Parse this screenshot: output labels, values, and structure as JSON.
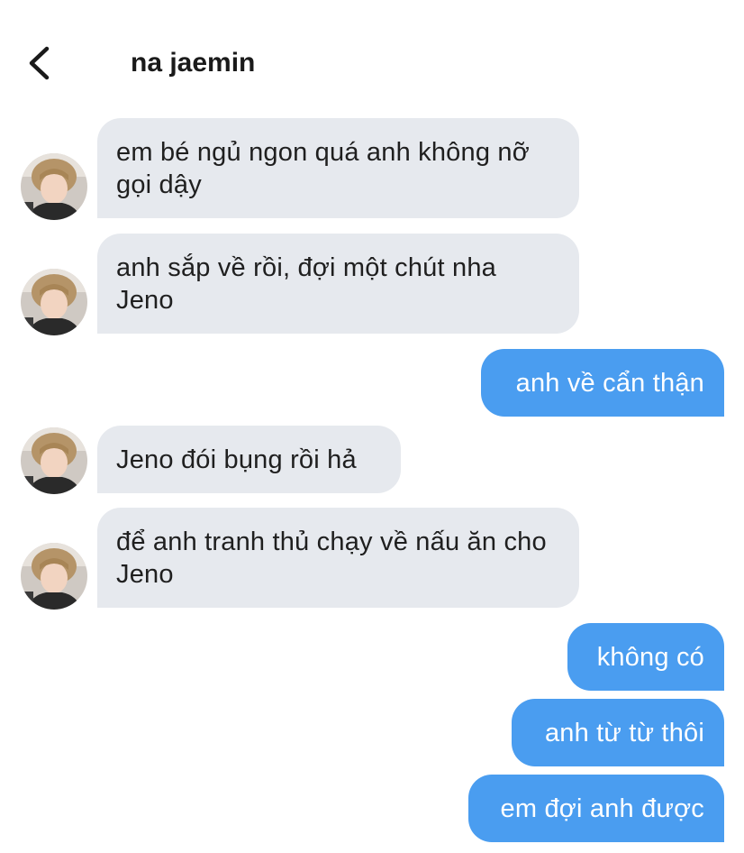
{
  "header": {
    "title": "na jaemin",
    "back_icon": "chevron-left-icon"
  },
  "colors": {
    "incoming_bubble": "#e6e9ee",
    "outgoing_bubble": "#4a9df0",
    "incoming_text": "#1f1f1f",
    "outgoing_text": "#ffffff"
  },
  "messages": [
    {
      "side": "incoming",
      "text": "em bé ngủ ngon quá anh không nỡ gọi dậy"
    },
    {
      "side": "incoming",
      "text": "anh sắp về rồi, đợi một chút nha Jeno"
    },
    {
      "side": "outgoing",
      "text": "anh về cẩn thận"
    },
    {
      "side": "incoming",
      "text": "Jeno đói bụng rồi hả"
    },
    {
      "side": "incoming",
      "text": "để anh tranh thủ chạy về nấu ăn cho Jeno"
    },
    {
      "side": "outgoing",
      "text": "không có"
    },
    {
      "side": "outgoing",
      "text": "anh từ từ thôi"
    },
    {
      "side": "outgoing",
      "text": "em đợi anh được"
    }
  ]
}
